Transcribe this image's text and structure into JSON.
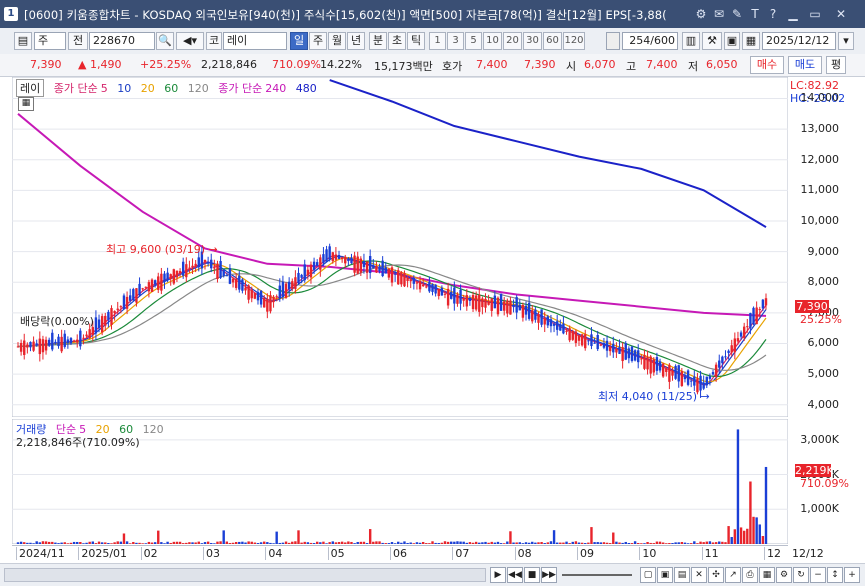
{
  "window": {
    "index": "1",
    "title": "[0600] 키움종합차트 - KOSDAQ 외국인보유[940(천)] 주식수[15,602(천)] 액면[500] 자본금[78(억)] 결산[12월] EPS[-3,88(",
    "icons": [
      "settings-icon",
      "message-icon",
      "pin-icon",
      "text-icon",
      "help-icon",
      "minimize-icon",
      "maximize-icon",
      "close-icon"
    ]
  },
  "toolbar": {
    "period_main": "주",
    "prev_label": "전",
    "stock_code": "228670",
    "stock_prefix": "코",
    "stock_name": "레이",
    "periods": [
      "일",
      "주",
      "월",
      "년",
      "분",
      "초",
      "틱"
    ],
    "selected_period": "일",
    "minute_options": [
      "1",
      "3",
      "5",
      "10",
      "20",
      "30",
      "60",
      "120"
    ],
    "count": "254",
    "total": "/600",
    "date": "2025/12/12"
  },
  "quote": {
    "price": "7,390",
    "change": "▲ 1,490",
    "change_pct": "+25.25%",
    "volume": "2,218,846",
    "vol_ratio": "710.09%",
    "turnover": "14.22%",
    "amount": "15,173백만",
    "hoga_label": "호가",
    "ask": "7,400",
    "bid": "7,390",
    "open_label": "시",
    "open": "6,070",
    "high_label": "고",
    "high": "7,400",
    "low_label": "저",
    "low": "6,050",
    "buy_btn": "매수",
    "sell_btn": "매도",
    "extra_btn": "평"
  },
  "price_legend": {
    "name": "레이",
    "ma_label": "종가 단순",
    "ma_periods": [
      "5",
      "10",
      "20",
      "60",
      "120"
    ],
    "ma_colors": [
      "#d4236a",
      "#1b3ec4",
      "#e8a200",
      "#1b8a3a",
      "#888888"
    ],
    "long_label": "종가 단순",
    "long_periods": [
      "240",
      "480"
    ],
    "long_colors": [
      "#c619b6",
      "#1b22c8"
    ]
  },
  "price_axis": {
    "ticks": [
      "14,000",
      "13,000",
      "12,000",
      "11,000",
      "10,000",
      "9,000",
      "8,000",
      "7,000",
      "6,000",
      "5,000",
      "4,000"
    ],
    "lc": "LC:82.92",
    "hc": "HC:-23.02",
    "last_price": "7,390",
    "last_pct": "25.25%"
  },
  "annotations": {
    "high": "최고 9,600 (03/19)",
    "low": "최저 4,040 (11/25)",
    "dividend": "배당락(0.00%)"
  },
  "volume_legend": {
    "label": "거래량",
    "ma_label": "단순",
    "periods": [
      "5",
      "20",
      "60",
      "120"
    ],
    "colors": [
      "#c619b6",
      "#e8a200",
      "#1b8a3a",
      "#888888"
    ],
    "summary": "2,218,846주(710.09%)"
  },
  "volume_axis": {
    "ticks": [
      "3,000K",
      "2,000K",
      "1,000K"
    ],
    "last_vol": "2,219K",
    "last_pct": "710.09%"
  },
  "time_axis": [
    "2024/11",
    "2025/01",
    "02",
    "03",
    "04",
    "05",
    "06",
    "07",
    "08",
    "09",
    "10",
    "11",
    "12",
    "12/12"
  ],
  "colors": {
    "up": "#e8242b",
    "down": "#1a3fd6",
    "ma240": "#c619b6",
    "ma480": "#1b22c8",
    "grid": "#e5e7ee"
  },
  "chart_data": {
    "type": "line",
    "title": "",
    "xlabel": "",
    "ylabel": "",
    "ylim": [
      3600,
      14700
    ],
    "x": [
      "2024/11",
      "2025/01",
      "02",
      "03",
      "04",
      "05",
      "06",
      "07",
      "08",
      "09",
      "10",
      "11",
      "12"
    ],
    "series": [
      {
        "name": "종가",
        "values": [
          5900,
          6100,
          7800,
          8700,
          7300,
          8900,
          8300,
          7500,
          7200,
          6200,
          5500,
          4600,
          7390
        ]
      },
      {
        "name": "240",
        "values": [
          13500,
          11800,
          10300,
          9100,
          8600,
          8500,
          8300,
          7900,
          7600,
          7400,
          7200,
          7000,
          6900
        ]
      },
      {
        "name": "480",
        "values": [
          null,
          null,
          null,
          null,
          null,
          14600,
          13900,
          13100,
          12600,
          12100,
          11700,
          11000,
          9800
        ]
      }
    ]
  }
}
